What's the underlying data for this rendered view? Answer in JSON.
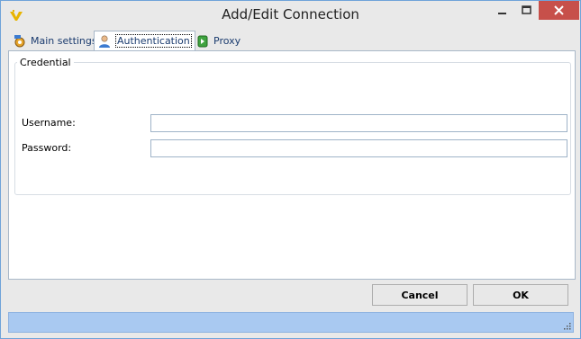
{
  "window": {
    "title": "Add/Edit Connection",
    "icon": "app-logo-icon",
    "controls": [
      "minimize-icon",
      "maximize-icon",
      "close-icon"
    ]
  },
  "tabs": [
    {
      "label": "Main settings",
      "icon": "settings-icon",
      "active": false
    },
    {
      "label": "Authentication",
      "icon": "user-icon",
      "active": true
    },
    {
      "label": "Proxy",
      "icon": "proxy-icon",
      "active": false
    }
  ],
  "credential": {
    "group_title": "Credential",
    "username_label": "Username:",
    "username_value": "",
    "password_label": "Password:",
    "password_value": ""
  },
  "buttons": {
    "cancel": "Cancel",
    "ok": "OK"
  },
  "colors": {
    "accent": "#a9c9f1",
    "close_button": "#c7504a",
    "tab_text": "#1a3b6e"
  }
}
